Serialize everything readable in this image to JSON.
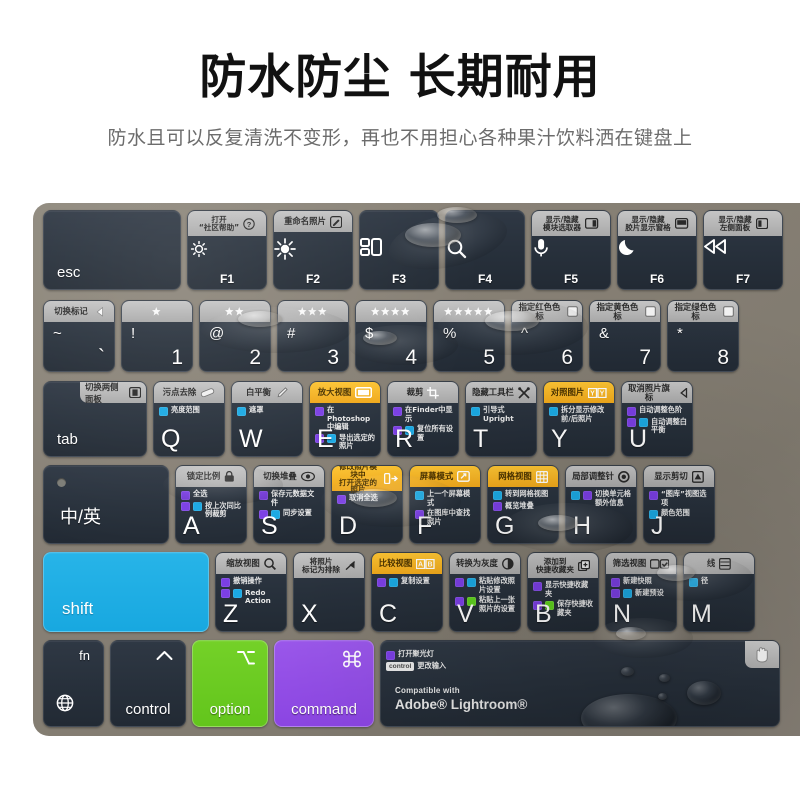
{
  "hero": {
    "title": "防水防尘 长期耐用",
    "subtitle": "防水且可以反复清洗不变形，再也不用担心各种果汁饮料洒在键盘上"
  },
  "colors": {
    "cover": "#877f74",
    "key": "#28313c",
    "strip_gray": "#b6b6b6",
    "strip_orange": "#f5b223",
    "shift_blue": "#1ea9e1",
    "option_green": "#6cc91f",
    "command_purple": "#8f4ae6",
    "chip_purple": "#7b3fe4",
    "chip_cyan": "#1ba9e3",
    "chip_green": "#5fd01e"
  },
  "keyboard": {
    "brand_line1": "Compatible with",
    "brand_line2": "Adobe® Lightroom®",
    "rows": [
      {
        "name": "function-row",
        "keys": [
          {
            "id": "esc",
            "label": "esc",
            "kind": "word"
          },
          {
            "id": "f1",
            "label": "F1",
            "kind": "fkey",
            "icon": "brightness-down-icon",
            "strip": {
              "text": "打开\n“社区帮助”",
              "icon": "question-circle-icon",
              "lines": 2
            }
          },
          {
            "id": "f2",
            "label": "F2",
            "kind": "fkey",
            "icon": "brightness-up-icon",
            "strip": {
              "text": "重命名照片",
              "icon": "rename-pencil-icon",
              "lines": 1
            }
          },
          {
            "id": "f3",
            "label": "F3",
            "kind": "fkey",
            "icon": "mission-control-icon"
          },
          {
            "id": "f4",
            "label": "F4",
            "kind": "fkey",
            "icon": "search-icon"
          },
          {
            "id": "f5",
            "label": "F5",
            "kind": "fkey",
            "icon": "microphone-icon",
            "strip": {
              "text": "显示/隐藏\n模块选取器",
              "icon": "panel-right-icon",
              "lines": 2
            }
          },
          {
            "id": "f6",
            "label": "F6",
            "kind": "fkey",
            "icon": "moon-icon",
            "strip": {
              "text": "显示/隐藏\n胶片显示窗格",
              "icon": "panel-bottom-icon",
              "lines": 2
            }
          },
          {
            "id": "f7",
            "label": "F7",
            "kind": "fkey",
            "icon": "rewind-icon",
            "strip": {
              "text": "显示/隐藏\n左侧面板",
              "icon": "panel-left-icon",
              "lines": 2
            }
          }
        ]
      },
      {
        "name": "number-row",
        "keys": [
          {
            "id": "tilde",
            "primary": "`",
            "secondary": "~",
            "kind": "num",
            "strip": {
              "text": "切换标记",
              "icon": "flag-icon",
              "lines": 1
            }
          },
          {
            "id": "one",
            "primary": "1",
            "secondary": "!",
            "kind": "num",
            "strip": {
              "text": "",
              "icon": "star-1-icon",
              "lines": 1
            }
          },
          {
            "id": "two",
            "primary": "2",
            "secondary": "@",
            "kind": "num",
            "strip": {
              "text": "",
              "icon": "star-2-icon",
              "lines": 1
            }
          },
          {
            "id": "three",
            "primary": "3",
            "secondary": "#",
            "kind": "num",
            "strip": {
              "text": "",
              "icon": "star-3-icon",
              "lines": 1
            }
          },
          {
            "id": "four",
            "primary": "4",
            "secondary": "$",
            "kind": "num",
            "strip": {
              "text": "",
              "icon": "star-4-icon",
              "lines": 1
            }
          },
          {
            "id": "five",
            "primary": "5",
            "secondary": "%",
            "kind": "num",
            "strip": {
              "text": "",
              "icon": "star-5-icon",
              "lines": 1
            }
          },
          {
            "id": "six",
            "primary": "6",
            "secondary": "^",
            "kind": "num",
            "strip": {
              "text": "指定红色色标",
              "icon": "swatch-icon",
              "lines": 1
            }
          },
          {
            "id": "seven",
            "primary": "7",
            "secondary": "&",
            "kind": "num",
            "strip": {
              "text": "指定黄色色标",
              "icon": "swatch-icon",
              "lines": 1
            }
          },
          {
            "id": "eight",
            "primary": "8",
            "secondary": "*",
            "kind": "num",
            "strip": {
              "text": "指定绿色色标",
              "icon": "swatch-icon",
              "lines": 1
            }
          }
        ]
      },
      {
        "name": "tab-row",
        "keys": [
          {
            "id": "tab",
            "label": "tab",
            "kind": "tab",
            "strip": {
              "text": "切换两侧面板",
              "icon": "panels-both-icon",
              "lines": 1
            }
          },
          {
            "id": "q",
            "label": "Q",
            "kind": "letter",
            "strip": {
              "text": "污点去除",
              "icon": "spot-removal-icon",
              "lines": 1
            },
            "shortcuts": [
              {
                "chips": [
                  "cyan"
                ],
                "text": "亮度范围"
              }
            ]
          },
          {
            "id": "w",
            "label": "W",
            "kind": "letter",
            "strip": {
              "text": "白平衡",
              "icon": "eyedropper-icon",
              "lines": 1
            },
            "shortcuts": [
              {
                "chips": [
                  "cyan"
                ],
                "text": "遮罩"
              }
            ]
          },
          {
            "id": "e",
            "label": "E",
            "kind": "letter",
            "highlight": "orange",
            "strip": {
              "text": "放大视图",
              "icon": "loupe-view-icon",
              "lines": 1
            },
            "shortcuts": [
              {
                "chips": [
                  "purple"
                ],
                "text": "在Photoshop中编辑"
              },
              {
                "chips": [
                  "purple",
                  "cyan"
                ],
                "text": "导出选定的照片"
              }
            ]
          },
          {
            "id": "r",
            "label": "R",
            "kind": "letter",
            "strip": {
              "text": "裁剪",
              "icon": "crop-icon",
              "lines": 1
            },
            "shortcuts": [
              {
                "chips": [
                  "purple"
                ],
                "text": "在Finder中显示"
              },
              {
                "chips": [
                  "purple",
                  "cyan"
                ],
                "text": "复位所有设置"
              }
            ]
          },
          {
            "id": "t",
            "label": "T",
            "kind": "letter",
            "strip": {
              "text": "隐藏工具栏",
              "icon": "tools-icon",
              "lines": 1
            },
            "shortcuts": [
              {
                "chips": [
                  "cyan"
                ],
                "text": "引导式Upright"
              }
            ]
          },
          {
            "id": "y",
            "label": "Y",
            "kind": "letter",
            "highlight": "orange",
            "strip": {
              "text": "对照图片",
              "icon": "yy-compare-icon",
              "lines": 1
            },
            "shortcuts": [
              {
                "chips": [
                  "cyan"
                ],
                "text": "拆分显示修改前/后照片"
              }
            ]
          },
          {
            "id": "u",
            "label": "U",
            "kind": "letter",
            "strip": {
              "text": "取消照片旗标",
              "icon": "unflag-icon",
              "lines": 1
            },
            "shortcuts": [
              {
                "chips": [
                  "purple"
                ],
                "text": "自动调整色阶"
              },
              {
                "chips": [
                  "purple",
                  "cyan"
                ],
                "text": "自动调整白平衡"
              }
            ]
          }
        ]
      },
      {
        "name": "home-row",
        "keys": [
          {
            "id": "capslock",
            "label": "中/英",
            "kind": "caps"
          },
          {
            "id": "a",
            "label": "A",
            "kind": "letter",
            "strip": {
              "text": "锁定比例",
              "icon": "lock-icon",
              "lines": 1
            },
            "shortcuts": [
              {
                "chips": [
                  "purple"
                ],
                "text": "全选"
              },
              {
                "chips": [
                  "purple",
                  "cyan"
                ],
                "text": "按上次同比例裁剪"
              }
            ]
          },
          {
            "id": "s",
            "label": "S",
            "kind": "letter",
            "strip": {
              "text": "切换堆叠",
              "icon": "eye-stack-icon",
              "lines": 1
            },
            "shortcuts": [
              {
                "chips": [
                  "purple"
                ],
                "text": "保存元数据文件"
              },
              {
                "chips": [
                  "purple",
                  "cyan"
                ],
                "text": "同步设置"
              }
            ]
          },
          {
            "id": "d",
            "label": "D",
            "kind": "letter",
            "highlight": "orange",
            "strip": {
              "text": "修改照片模块中\n打开选定的照片",
              "icon": "develop-module-icon",
              "lines": 2
            },
            "shortcuts": [
              {
                "chips": [
                  "purple"
                ],
                "text": "取消全选"
              }
            ]
          },
          {
            "id": "f",
            "label": "F",
            "kind": "letter",
            "highlight": "orange",
            "strip": {
              "text": "屏幕模式",
              "icon": "screen-mode-icon",
              "lines": 1
            },
            "shortcuts": [
              {
                "chips": [
                  "cyan"
                ],
                "text": "上一个屏幕模式"
              },
              {
                "chips": [
                  "purple"
                ],
                "text": "在图库中查找照片"
              }
            ]
          },
          {
            "id": "g",
            "label": "G",
            "kind": "letter",
            "highlight": "orange",
            "strip": {
              "text": "网格视图",
              "icon": "grid-view-icon",
              "lines": 1
            },
            "shortcuts": [
              {
                "chips": [
                  "cyan"
                ],
                "text": "转到网格视图"
              },
              {
                "chips": [
                  "purple"
                ],
                "text": "概览堆叠"
              }
            ]
          },
          {
            "id": "h",
            "label": "H",
            "kind": "letter",
            "strip": {
              "text": "局部调整针",
              "icon": "adjustment-pin-icon",
              "lines": 1
            },
            "shortcuts": [
              {
                "chips": [
                  "cyan",
                  "purple"
                ],
                "text": "切换单元格额外信息"
              }
            ]
          },
          {
            "id": "j",
            "label": "J",
            "kind": "letter",
            "strip": {
              "text": "显示剪切",
              "icon": "clipping-icon",
              "lines": 1
            },
            "shortcuts": [
              {
                "chips": [
                  "purple"
                ],
                "text": "“图库”视图选项"
              },
              {
                "chips": [
                  "cyan"
                ],
                "text": "颜色范围"
              }
            ]
          }
        ]
      },
      {
        "name": "shift-row",
        "keys": [
          {
            "id": "shift",
            "label": "shift",
            "kind": "shift",
            "highlight": "blue"
          },
          {
            "id": "z",
            "label": "Z",
            "kind": "letter",
            "strip": {
              "text": "缩放视图",
              "icon": "zoom-view-icon",
              "lines": 1
            },
            "shortcuts": [
              {
                "chips": [
                  "purple"
                ],
                "text": "撤销操作"
              },
              {
                "chips": [
                  "purple",
                  "cyan"
                ],
                "text": "Redo Action"
              }
            ]
          },
          {
            "id": "x",
            "label": "X",
            "kind": "letter",
            "strip": {
              "text": "将照片\n标记为排除",
              "icon": "reject-flag-icon",
              "lines": 2
            }
          },
          {
            "id": "c",
            "label": "C",
            "kind": "letter",
            "highlight": "orange",
            "strip": {
              "text": "比较视图",
              "icon": "ab-compare-icon",
              "lines": 1
            },
            "shortcuts": [
              {
                "chips": [
                  "purple",
                  "cyan"
                ],
                "text": "复制设置"
              }
            ]
          },
          {
            "id": "v",
            "label": "V",
            "kind": "letter",
            "strip": {
              "text": "转换为灰度",
              "icon": "grayscale-icon",
              "lines": 1
            },
            "shortcuts": [
              {
                "chips": [
                  "purple",
                  "cyan"
                ],
                "text": "粘贴修改照片设置"
              },
              {
                "chips": [
                  "purple",
                  "green"
                ],
                "text": "粘贴上一张照片的设置"
              }
            ]
          },
          {
            "id": "b",
            "label": "B",
            "kind": "letter",
            "strip": {
              "text": "添加到\n快捷收藏夹",
              "icon": "add-collection-icon",
              "lines": 2
            },
            "shortcuts": [
              {
                "chips": [
                  "purple"
                ],
                "text": "显示快捷收藏夹"
              },
              {
                "chips": [
                  "purple",
                  "green"
                ],
                "text": "保存快捷收藏夹"
              }
            ]
          },
          {
            "id": "n",
            "label": "N",
            "kind": "letter",
            "strip": {
              "text": "筛选视图",
              "icon": "survey-view-icon",
              "lines": 1
            },
            "shortcuts": [
              {
                "chips": [
                  "purple"
                ],
                "text": "新建快照"
              },
              {
                "chips": [
                  "purple",
                  "cyan"
                ],
                "text": "新建预设"
              }
            ]
          },
          {
            "id": "m",
            "label": "M",
            "kind": "letter",
            "strip": {
              "text": "线",
              "icon": "gradient-icon",
              "lines": 1
            },
            "shortcuts": [
              {
                "chips": [
                  "cyan"
                ],
                "text": "径"
              }
            ]
          }
        ]
      },
      {
        "name": "bottom-row",
        "keys": [
          {
            "id": "fn",
            "label": "fn",
            "kind": "fn",
            "icon": "globe-icon"
          },
          {
            "id": "control",
            "label": "control",
            "kind": "mod",
            "icon": "control-caret-icon"
          },
          {
            "id": "option",
            "label": "option",
            "kind": "mod",
            "highlight": "green",
            "icon": "option-glyph-icon"
          },
          {
            "id": "command",
            "label": "command",
            "kind": "mod",
            "highlight": "purple",
            "icon": "command-glyph-icon"
          },
          {
            "id": "space",
            "kind": "space",
            "shortcuts": [
              {
                "chips": [
                  "purple"
                ],
                "text": "打开聚光灯"
              },
              {
                "chips": [
                  "ctrl"
                ],
                "text": "更改输入"
              }
            ]
          }
        ]
      }
    ]
  }
}
